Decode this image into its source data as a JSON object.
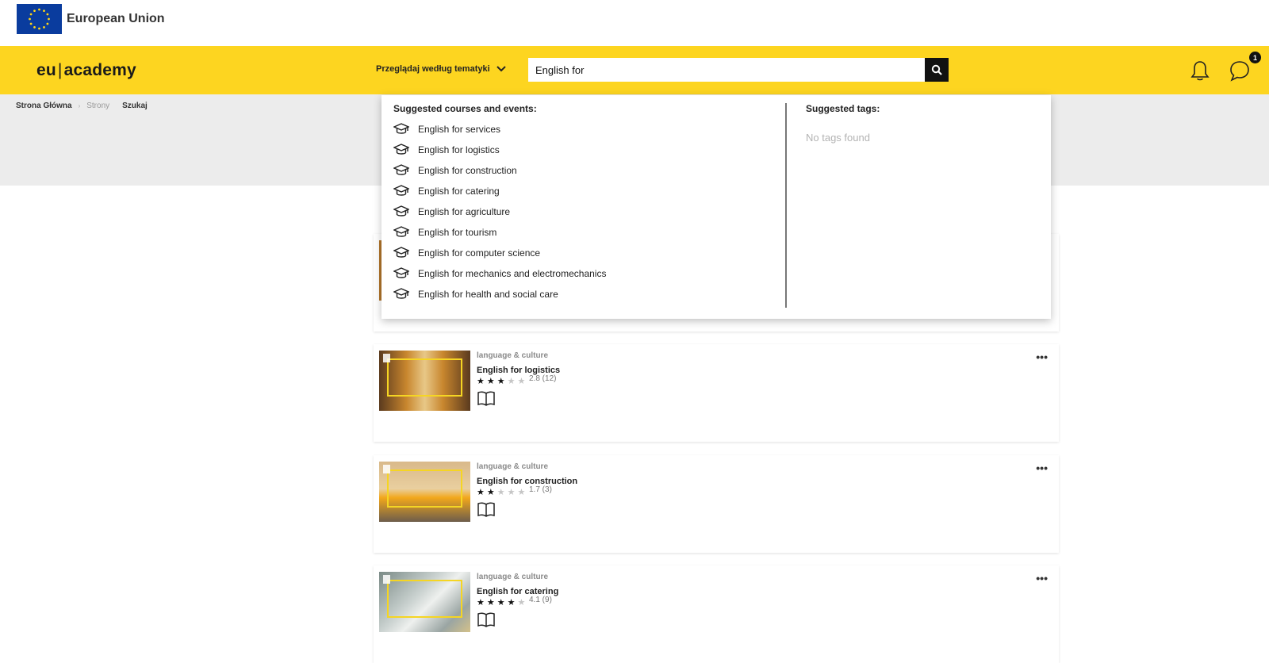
{
  "eu_header": {
    "title": "European Union"
  },
  "topbar": {
    "logo_left": "eu",
    "logo_sep": "|",
    "logo_right": "academy",
    "browse_label": "Przeglądaj według tematyki",
    "search_value": "English for",
    "notifications_badge": "1"
  },
  "breadcrumb": {
    "home": "Strona Główna",
    "pages": "Strony",
    "current": "Szukaj"
  },
  "suggestions": {
    "courses_heading": "Suggested courses and events:",
    "courses": [
      "English for services",
      "English for logistics",
      "English for construction",
      "English for catering",
      "English for agriculture",
      "English for tourism",
      "English for computer science",
      "English for mechanics and electromechanics",
      "English for health and social care"
    ],
    "tags_heading": "Suggested tags:",
    "tags_empty": "No tags found"
  },
  "results": [
    {
      "category": "language & culture",
      "title": "English for logistics",
      "rating_value": 2.8,
      "rating_text": "2.8 (12)",
      "stars_filled": 3,
      "more": "•••"
    },
    {
      "category": "language & culture",
      "title": "English for construction",
      "rating_value": 1.7,
      "rating_text": "1.7 (3)",
      "stars_filled": 2,
      "more": "•••"
    },
    {
      "category": "language & culture",
      "title": "English for catering",
      "rating_value": 4.1,
      "rating_text": "4.1 (9)",
      "stars_filled": 4,
      "more": "•••"
    }
  ],
  "colors": {
    "brand_yellow": "#fdd520",
    "eu_blue": "#0a3c9e",
    "dark": "#111111"
  },
  "icons": [
    "eu-flag-icon",
    "chevron-down-icon",
    "search-icon",
    "bell-icon",
    "chat-icon",
    "graduation-cap-icon",
    "bookmark-icon",
    "star-icon",
    "book-icon",
    "more-icon"
  ]
}
